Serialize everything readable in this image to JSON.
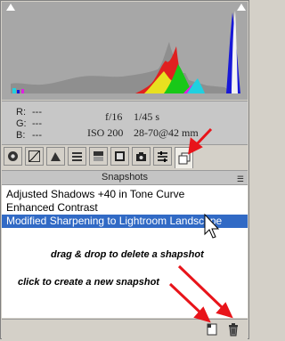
{
  "readout": {
    "r_label": "R:",
    "r_value": "---",
    "g_label": "G:",
    "g_value": "---",
    "b_label": "B:",
    "b_value": "---",
    "aperture": "f/16",
    "shutter": "1/45 s",
    "iso": "ISO 200",
    "lens": "28-70@42 mm"
  },
  "tabs": [
    {
      "icon": "aperture-icon"
    },
    {
      "icon": "tone-curve-icon"
    },
    {
      "icon": "detail-icon"
    },
    {
      "icon": "hsl-icon"
    },
    {
      "icon": "split-toning-icon"
    },
    {
      "icon": "lens-corrections-icon"
    },
    {
      "icon": "camera-calibration-icon"
    },
    {
      "icon": "presets-icon"
    },
    {
      "icon": "snapshots-icon"
    }
  ],
  "panel": {
    "title": "Snapshots"
  },
  "snapshots": [
    {
      "label": "Adjusted Shadows +40 in Tone Curve"
    },
    {
      "label": "Enhanced Contrast"
    },
    {
      "label": "Modified Sharpening to Lightroom Landscape"
    }
  ],
  "annotations": {
    "drag": "drag & drop to delete a shapshot",
    "click": "click to create a new snapshot"
  },
  "colors": {
    "selection": "#316ac5",
    "arrow": "#e8141a",
    "histogram_bg": "#a7a7a7"
  }
}
